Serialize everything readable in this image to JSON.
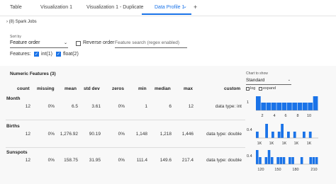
{
  "tabs": [
    {
      "label": "Table"
    },
    {
      "label": "Visualization 1"
    },
    {
      "label": "Visualization 1 - Duplicate"
    },
    {
      "label": "Data Profile 1"
    }
  ],
  "tab_add": "+",
  "tab_chevron": "⌄",
  "spark_jobs": "› (8) Spark Jobs",
  "controls": {
    "sort_by_label": "Sort by",
    "sort_value": "Feature order",
    "reverse_order": "Reverse order",
    "search_placeholder": "Feature search (regex enabled)",
    "features_label": "Features:",
    "feature_int": "int(1)",
    "feature_float": "float(2)"
  },
  "numeric": {
    "title": "Numeric Features (3)",
    "chart_to_show_label": "Chart to show",
    "chart_to_show": "Standard",
    "log_label": "log",
    "expand_label": "expand",
    "columns": [
      "count",
      "missing",
      "mean",
      "std dev",
      "zeros",
      "min",
      "median",
      "max",
      "custom"
    ],
    "rows": [
      {
        "name": "Month",
        "values": [
          "12",
          "0%",
          "6.5",
          "3.61",
          "0%",
          "1",
          "6",
          "12",
          "data type: int"
        ],
        "hist_ticks": [
          "2",
          "4",
          "6",
          "8",
          "10"
        ],
        "y_label": "1",
        "hist": [
          1,
          0.55,
          0.55,
          0.55,
          0.55,
          0.55,
          0.55,
          0.55,
          0.55,
          0.55,
          0.55,
          1
        ]
      },
      {
        "name": "Births",
        "values": [
          "12",
          "0%",
          "1,276.92",
          "90.19",
          "0%",
          "1,148",
          "1,218",
          "1,446",
          "data type: double"
        ],
        "hist_ticks": [
          "1K",
          "1K",
          "1K",
          "1K",
          "1K"
        ],
        "y_label": "0.4",
        "hist": [
          0.45,
          0,
          0,
          1,
          0,
          0.45,
          0,
          0.45,
          1,
          0,
          0.45,
          0,
          0.45,
          0,
          0,
          0.45,
          0,
          0.45,
          0,
          0
        ]
      },
      {
        "name": "Sunspots",
        "values": [
          "12",
          "0%",
          "158.75",
          "31.95",
          "0%",
          "111.4",
          "149.6",
          "217.4",
          "data type: double"
        ],
        "hist_ticks": [
          "120",
          "150",
          "180",
          "210"
        ],
        "y_label": "0.4",
        "hist": [
          1,
          0.5,
          0,
          0.5,
          1,
          0.5,
          0,
          0.5,
          0.5,
          0.5,
          0,
          0.5,
          0.5,
          0,
          0,
          0.5,
          0,
          0,
          0.5,
          0.5,
          0.5
        ]
      }
    ]
  }
}
